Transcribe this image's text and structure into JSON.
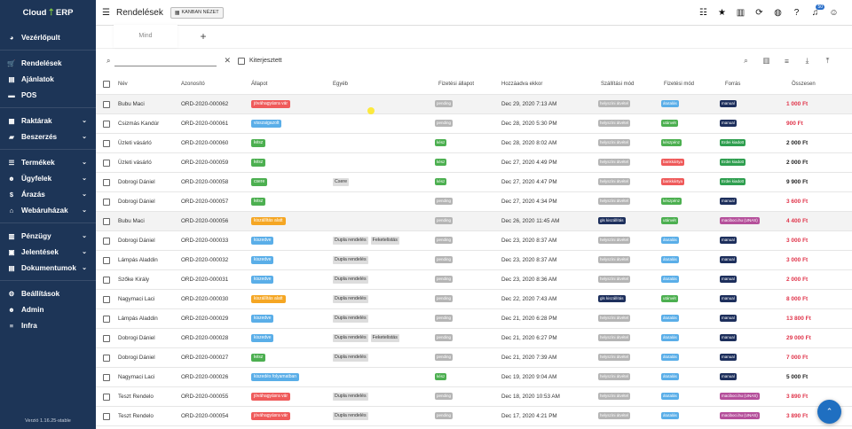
{
  "sidebar": {
    "logo_left": "Cloud",
    "logo_right": "ERP",
    "groups": [
      [
        {
          "label": "Vezérlőpult",
          "icon": "dashboard-icon",
          "glyph": "◕",
          "chev": false
        }
      ],
      [
        {
          "label": "Rendelések",
          "icon": "cart-icon",
          "glyph": "🛒",
          "chev": false
        },
        {
          "label": "Ajánlatok",
          "icon": "document-icon",
          "glyph": "▤",
          "chev": false
        },
        {
          "label": "POS",
          "icon": "pos-icon",
          "glyph": "▬",
          "chev": false
        }
      ],
      [
        {
          "label": "Raktárak",
          "icon": "warehouse-icon",
          "glyph": "▦",
          "chev": true
        },
        {
          "label": "Beszerzés",
          "icon": "truck-icon",
          "glyph": "▰",
          "chev": true
        }
      ],
      [
        {
          "label": "Termékek",
          "icon": "list-icon",
          "glyph": "☰",
          "chev": true
        },
        {
          "label": "Ügyfelek",
          "icon": "users-icon",
          "glyph": "☻",
          "chev": true
        },
        {
          "label": "Árazás",
          "icon": "dollar-icon",
          "glyph": "$",
          "chev": true
        },
        {
          "label": "Webáruházak",
          "icon": "store-icon",
          "glyph": "⌂",
          "chev": true
        }
      ],
      [
        {
          "label": "Pénzügy",
          "icon": "finance-icon",
          "glyph": "▥",
          "chev": true
        },
        {
          "label": "Jelentések",
          "icon": "report-icon",
          "glyph": "▣",
          "chev": true
        },
        {
          "label": "Dokumentumok",
          "icon": "folder-icon",
          "glyph": "▤",
          "chev": true
        }
      ],
      [
        {
          "label": "Beállítások",
          "icon": "gear-icon",
          "glyph": "⚙",
          "chev": false
        },
        {
          "label": "Admin",
          "icon": "admin-icon",
          "glyph": "☻",
          "chev": false
        },
        {
          "label": "Infra",
          "icon": "server-icon",
          "glyph": "≡",
          "chev": false
        }
      ]
    ],
    "version": "Verzió 1.16.25-stable"
  },
  "header": {
    "title": "Rendelések",
    "kanban_label": "KANBAN NÉZET",
    "notification_count": "50"
  },
  "tabs": {
    "all_label": "Mind",
    "add_label": "+"
  },
  "filter": {
    "search_value": "",
    "search_placeholder": "",
    "checkbox_label": "Kiterjesztett"
  },
  "table": {
    "headers": {
      "nev": "Név",
      "azonosito": "Azonosító",
      "allapot": "Állapot",
      "egyeb": "Egyéb",
      "fizetesi_allapot": "Fizetési állapot",
      "hozzaadva": "Hozzáadva ekkor",
      "szallitasi_mod": "Szállítási mód",
      "fizetesi_mod": "Fizetési mód",
      "forras": "Forrás",
      "osszesen": "Összesen"
    },
    "rows": [
      {
        "nev": "Bubu Maci",
        "azonosito": "ORD-2020-000062",
        "allapot": "jóváhagyásra vár",
        "allapot_color": "#ef5a5a",
        "egyeb": [],
        "fizetes": "pending",
        "fizetes_color": "#b5b5b5",
        "hozzaadva": "Dec 29, 2020 7:13 AM",
        "szallitas": "helyszíni átvétel",
        "szallitas_color": "#b5b5b5",
        "fizmod": "átutalás",
        "fizmod_color": "#5aaee8",
        "forras": "manual",
        "forras_color": "#1d2f5c",
        "osszesen": "1 000 Ft",
        "osszesen_color": "#e0344a"
      },
      {
        "nev": "Csizmás Kandúr",
        "azonosito": "ORD-2020-000061",
        "allapot": "visszaigazolt",
        "allapot_color": "#5aaee8",
        "egyeb": [],
        "fizetes": "pending",
        "fizetes_color": "#b5b5b5",
        "hozzaadva": "Dec 28, 2020 5:30 PM",
        "szallitas": "helyszíni átvétel",
        "szallitas_color": "#b5b5b5",
        "fizmod": "utánvét",
        "fizmod_color": "#4caf50",
        "forras": "manual",
        "forras_color": "#1d2f5c",
        "osszesen": "900 Ft",
        "osszesen_color": "#e0344a"
      },
      {
        "nev": "Üzleti vásárló",
        "azonosito": "ORD-2020-000060",
        "allapot": "kész",
        "allapot_color": "#4caf50",
        "egyeb": [],
        "fizetes": "kész",
        "fizetes_color": "#4caf50",
        "hozzaadva": "Dec 28, 2020 8:02 AM",
        "szallitas": "helyszíni átvétel",
        "szallitas_color": "#b5b5b5",
        "fizmod": "készpénz",
        "fizmod_color": "#4caf50",
        "forras": "Erdei kiadott",
        "forras_color": "#2e9e4f",
        "osszesen": "2 000 Ft",
        "osszesen_color": "#222222"
      },
      {
        "nev": "Üzleti vásárló",
        "azonosito": "ORD-2020-000059",
        "allapot": "kész",
        "allapot_color": "#4caf50",
        "egyeb": [],
        "fizetes": "kész",
        "fizetes_color": "#4caf50",
        "hozzaadva": "Dec 27, 2020 4:49 PM",
        "szallitas": "helyszíni átvétel",
        "szallitas_color": "#b5b5b5",
        "fizmod": "bankkártya",
        "fizmod_color": "#ef5a5a",
        "forras": "Erdei kiadott",
        "forras_color": "#2e9e4f",
        "osszesen": "2 000 Ft",
        "osszesen_color": "#222222"
      },
      {
        "nev": "Dobrogi Dániel",
        "azonosito": "ORD-2020-000058",
        "allapot": "csere",
        "allapot_color": "#4caf50",
        "egyeb": [
          "Csere"
        ],
        "fizetes": "kész",
        "fizetes_color": "#4caf50",
        "hozzaadva": "Dec 27, 2020 4:47 PM",
        "szallitas": "helyszíni átvétel",
        "szallitas_color": "#b5b5b5",
        "fizmod": "bankkártya",
        "fizmod_color": "#ef5a5a",
        "forras": "Erdei kiadott",
        "forras_color": "#2e9e4f",
        "osszesen": "9 900 Ft",
        "osszesen_color": "#222222"
      },
      {
        "nev": "Dobrogi Dániel",
        "azonosito": "ORD-2020-000057",
        "allapot": "kész",
        "allapot_color": "#4caf50",
        "egyeb": [],
        "fizetes": "pending",
        "fizetes_color": "#b5b5b5",
        "hozzaadva": "Dec 27, 2020 4:34 PM",
        "szallitas": "helyszíni átvétel",
        "szallitas_color": "#b5b5b5",
        "fizmod": "készpénz",
        "fizmod_color": "#4caf50",
        "forras": "manual",
        "forras_color": "#1d2f5c",
        "osszesen": "3 600 Ft",
        "osszesen_color": "#e0344a"
      },
      {
        "nev": "Bubu Maci",
        "azonosito": "ORD-2020-000056",
        "allapot": "kiszállítás alatt",
        "allapot_color": "#f5a623",
        "egyeb": [],
        "fizetes": "pending",
        "fizetes_color": "#b5b5b5",
        "hozzaadva": "Dec 26, 2020 11:45 AM",
        "szallitas": "gls kiszállítás",
        "szallitas_color": "#1d2f5c",
        "fizmod": "utánvét",
        "fizmod_color": "#4caf50",
        "forras": "maciboci.hu (UNAS)",
        "forras_color": "#b5509b",
        "osszesen": "4 400 Ft",
        "osszesen_color": "#e0344a"
      },
      {
        "nev": "Dobrogi Dániel",
        "azonosito": "ORD-2020-000033",
        "allapot": "kiszedve",
        "allapot_color": "#5aaee8",
        "egyeb": [
          "Dupla rendelés",
          "Feketelistás"
        ],
        "fizetes": "pending",
        "fizetes_color": "#b5b5b5",
        "hozzaadva": "Dec 23, 2020 8:37 AM",
        "szallitas": "helyszíni átvétel",
        "szallitas_color": "#b5b5b5",
        "fizmod": "átutalás",
        "fizmod_color": "#5aaee8",
        "forras": "manual",
        "forras_color": "#1d2f5c",
        "osszesen": "3 000 Ft",
        "osszesen_color": "#e0344a"
      },
      {
        "nev": "Lámpás Aladdin",
        "azonosito": "ORD-2020-000032",
        "allapot": "kiszedve",
        "allapot_color": "#5aaee8",
        "egyeb": [
          "Dupla rendelés"
        ],
        "fizetes": "pending",
        "fizetes_color": "#b5b5b5",
        "hozzaadva": "Dec 23, 2020 8:37 AM",
        "szallitas": "helyszíni átvétel",
        "szallitas_color": "#b5b5b5",
        "fizmod": "átutalás",
        "fizmod_color": "#5aaee8",
        "forras": "manual",
        "forras_color": "#1d2f5c",
        "osszesen": "3 000 Ft",
        "osszesen_color": "#e0344a"
      },
      {
        "nev": "Szőke Király",
        "azonosito": "ORD-2020-000031",
        "allapot": "kiszedve",
        "allapot_color": "#5aaee8",
        "egyeb": [
          "Dupla rendelés"
        ],
        "fizetes": "pending",
        "fizetes_color": "#b5b5b5",
        "hozzaadva": "Dec 23, 2020 8:36 AM",
        "szallitas": "helyszíni átvétel",
        "szallitas_color": "#b5b5b5",
        "fizmod": "átutalás",
        "fizmod_color": "#5aaee8",
        "forras": "manual",
        "forras_color": "#1d2f5c",
        "osszesen": "2 000 Ft",
        "osszesen_color": "#e0344a"
      },
      {
        "nev": "Nagymaci Laci",
        "azonosito": "ORD-2020-000030",
        "allapot": "kiszállítás alatt",
        "allapot_color": "#f5a623",
        "egyeb": [
          "Dupla rendelés"
        ],
        "fizetes": "pending",
        "fizetes_color": "#b5b5b5",
        "hozzaadva": "Dec 22, 2020 7:43 AM",
        "szallitas": "gls kiszállítás",
        "szallitas_color": "#1d2f5c",
        "fizmod": "utánvét",
        "fizmod_color": "#4caf50",
        "forras": "manual",
        "forras_color": "#1d2f5c",
        "osszesen": "8 000 Ft",
        "osszesen_color": "#e0344a"
      },
      {
        "nev": "Lámpás Aladdin",
        "azonosito": "ORD-2020-000029",
        "allapot": "kiszedve",
        "allapot_color": "#5aaee8",
        "egyeb": [
          "Dupla rendelés"
        ],
        "fizetes": "pending",
        "fizetes_color": "#b5b5b5",
        "hozzaadva": "Dec 21, 2020 6:28 PM",
        "szallitas": "helyszíni átvétel",
        "szallitas_color": "#b5b5b5",
        "fizmod": "átutalás",
        "fizmod_color": "#5aaee8",
        "forras": "manual",
        "forras_color": "#1d2f5c",
        "osszesen": "13 800 Ft",
        "osszesen_color": "#e0344a"
      },
      {
        "nev": "Dobrogi Dániel",
        "azonosito": "ORD-2020-000028",
        "allapot": "kiszedve",
        "allapot_color": "#5aaee8",
        "egyeb": [
          "Dupla rendelés",
          "Feketelistás"
        ],
        "fizetes": "pending",
        "fizetes_color": "#b5b5b5",
        "hozzaadva": "Dec 21, 2020 6:27 PM",
        "szallitas": "helyszíni átvétel",
        "szallitas_color": "#b5b5b5",
        "fizmod": "átutalás",
        "fizmod_color": "#5aaee8",
        "forras": "manual",
        "forras_color": "#1d2f5c",
        "osszesen": "29 000 Ft",
        "osszesen_color": "#e0344a"
      },
      {
        "nev": "Dobrogi Dániel",
        "azonosito": "ORD-2020-000027",
        "allapot": "kész",
        "allapot_color": "#4caf50",
        "egyeb": [
          "Dupla rendelés"
        ],
        "fizetes": "pending",
        "fizetes_color": "#b5b5b5",
        "hozzaadva": "Dec 21, 2020 7:39 AM",
        "szallitas": "helyszíni átvétel",
        "szallitas_color": "#b5b5b5",
        "fizmod": "átutalás",
        "fizmod_color": "#5aaee8",
        "forras": "manual",
        "forras_color": "#1d2f5c",
        "osszesen": "7 000 Ft",
        "osszesen_color": "#e0344a"
      },
      {
        "nev": "Nagymaci Laci",
        "azonosito": "ORD-2020-000026",
        "allapot": "kiszedés folyamatban",
        "allapot_color": "#5aaee8",
        "egyeb": [],
        "fizetes": "kész",
        "fizetes_color": "#4caf50",
        "hozzaadva": "Dec 19, 2020 9:04 AM",
        "szallitas": "helyszíni átvétel",
        "szallitas_color": "#b5b5b5",
        "fizmod": "átutalás",
        "fizmod_color": "#5aaee8",
        "forras": "manual",
        "forras_color": "#1d2f5c",
        "osszesen": "5 000 Ft",
        "osszesen_color": "#222222"
      },
      {
        "nev": "Teszt Rendelo",
        "azonosito": "ORD-2020-000055",
        "allapot": "jóváhagyásra vár",
        "allapot_color": "#ef5a5a",
        "egyeb": [
          "Dupla rendelés"
        ],
        "fizetes": "pending",
        "fizetes_color": "#b5b5b5",
        "hozzaadva": "Dec 18, 2020 10:53 AM",
        "szallitas": "helyszíni átvétel",
        "szallitas_color": "#b5b5b5",
        "fizmod": "átutalás",
        "fizmod_color": "#5aaee8",
        "forras": "maciboci.hu (UNAS)",
        "forras_color": "#b5509b",
        "osszesen": "3 890 Ft",
        "osszesen_color": "#e0344a"
      },
      {
        "nev": "Teszt Rendelo",
        "azonosito": "ORD-2020-000054",
        "allapot": "jóváhagyásra vár",
        "allapot_color": "#ef5a5a",
        "egyeb": [
          "Dupla rendelés"
        ],
        "fizetes": "pending",
        "fizetes_color": "#b5b5b5",
        "hozzaadva": "Dec 17, 2020 4:21 PM",
        "szallitas": "helyszíni átvétel",
        "szallitas_color": "#b5b5b5",
        "fizmod": "átutalás",
        "fizmod_color": "#5aaee8",
        "forras": "maciboci.hu (UNAS)",
        "forras_color": "#b5509b",
        "osszesen": "3 890 Ft",
        "osszesen_color": "#e0344a"
      }
    ]
  },
  "fab": {
    "icon": "chevron-up-icon"
  }
}
